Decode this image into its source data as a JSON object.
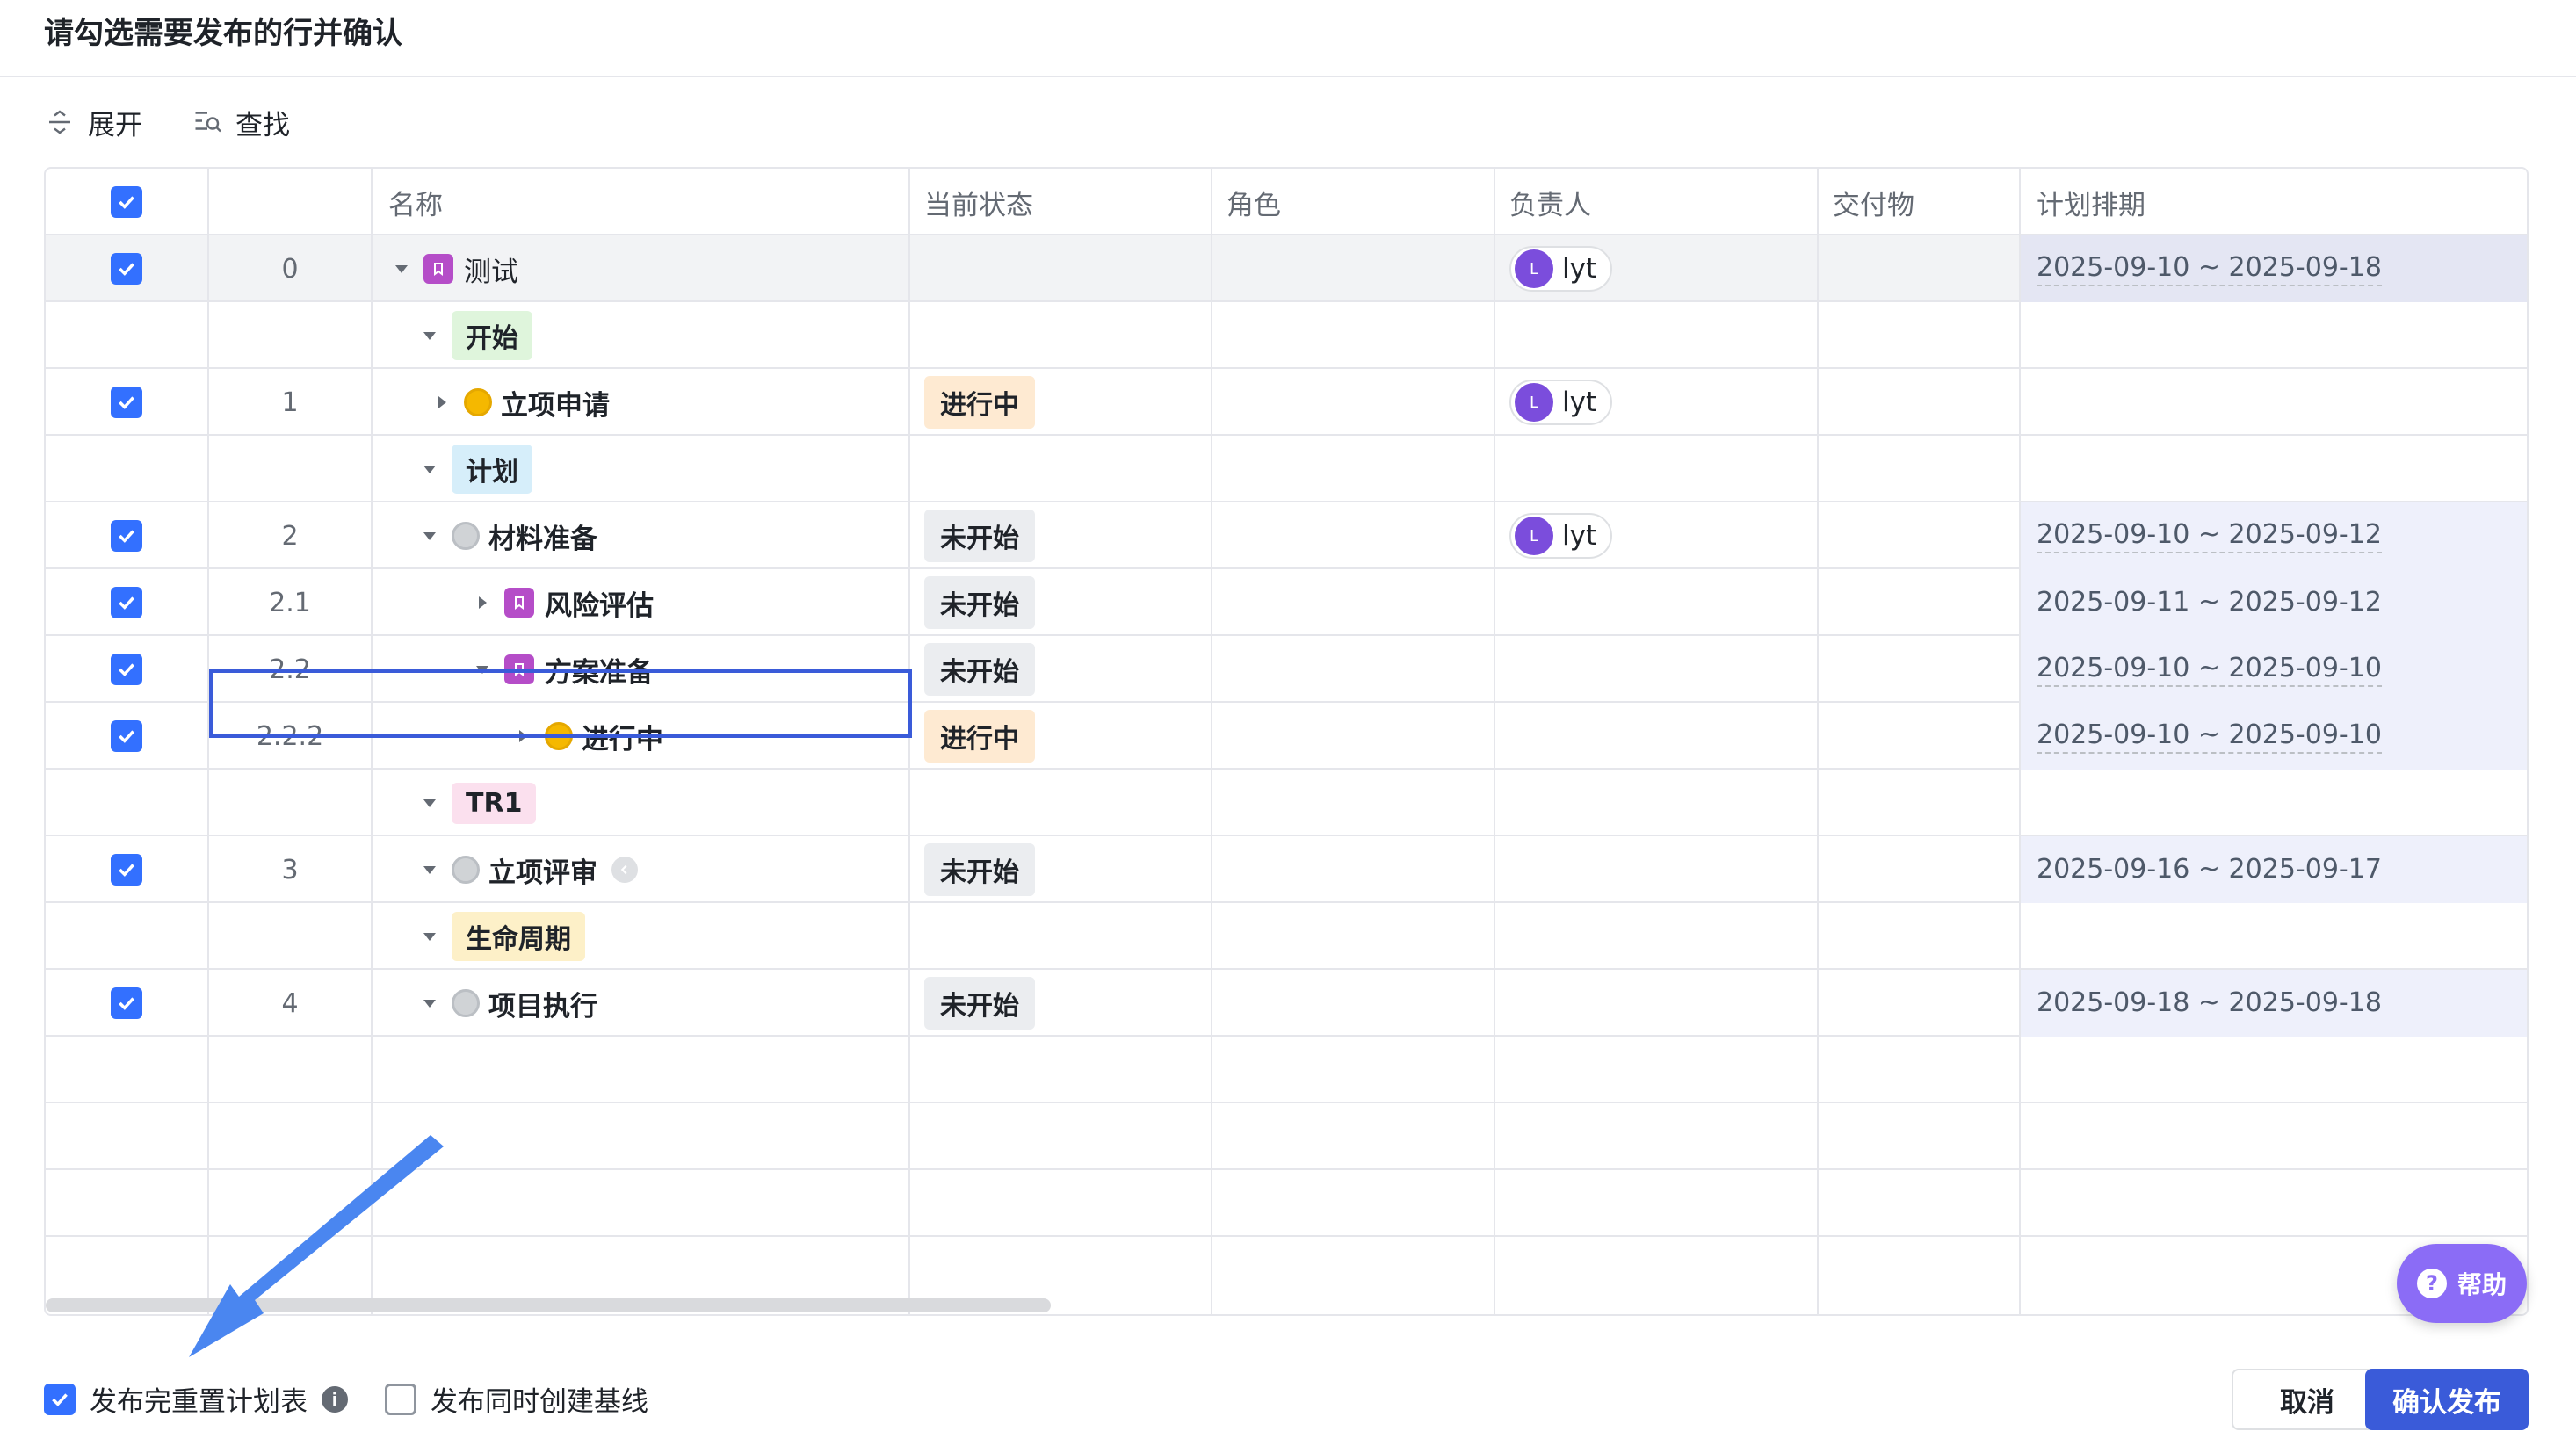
{
  "dialog": {
    "title": "请勾选需要发布的行并确认"
  },
  "toolbar": {
    "expand_label": "展开",
    "find_label": "查找"
  },
  "table": {
    "columns": [
      "名称",
      "当前状态",
      "角色",
      "负责人",
      "交付物",
      "计划排期"
    ],
    "rows": [
      {
        "index": "0",
        "name": "测试",
        "status": "",
        "owner_initial": "L",
        "owner": "lyt",
        "schedule": "2025-09-10 ~ 2025-09-18"
      },
      {
        "phase": "开始"
      },
      {
        "index": "1",
        "name": "立项申请",
        "status": "进行中",
        "owner_initial": "L",
        "owner": "lyt",
        "schedule": ""
      },
      {
        "phase": "计划"
      },
      {
        "index": "2",
        "name": "材料准备",
        "status": "未开始",
        "owner_initial": "L",
        "owner": "lyt",
        "schedule": "2025-09-10 ~ 2025-09-12"
      },
      {
        "index": "2.1",
        "name": "风险评估",
        "status": "未开始",
        "owner": "",
        "schedule": "2025-09-11 ~ 2025-09-12"
      },
      {
        "index": "2.2",
        "name": "方案准备",
        "status": "未开始",
        "owner": "",
        "schedule": "2025-09-10 ~ 2025-09-10"
      },
      {
        "index": "2.2.2",
        "name": "进行中",
        "status": "进行中",
        "owner": "",
        "schedule": "2025-09-10 ~ 2025-09-10"
      },
      {
        "phase": "TR1"
      },
      {
        "index": "3",
        "name": "立项评审",
        "status": "未开始",
        "owner": "",
        "schedule": "2025-09-16 ~ 2025-09-17"
      },
      {
        "phase": "生命周期"
      },
      {
        "index": "4",
        "name": "项目执行",
        "status": "未开始",
        "owner": "",
        "schedule": "2025-09-18 ~ 2025-09-18"
      }
    ]
  },
  "help": {
    "label": "帮助"
  },
  "footer": {
    "reset_plan_label": "发布完重置计划表",
    "baseline_label": "发布同时创建基线",
    "cancel_label": "取消",
    "confirm_label": "确认发布"
  },
  "colors": {
    "primary": "#3a5bd9",
    "checkbox": "#3370ff",
    "milestone": "#b54dc8",
    "phase_start": "#dff5dc",
    "phase_plan": "#d6eefa",
    "phase_tr1": "#fbe0ee",
    "phase_lifecycle": "#fdf0c8"
  }
}
